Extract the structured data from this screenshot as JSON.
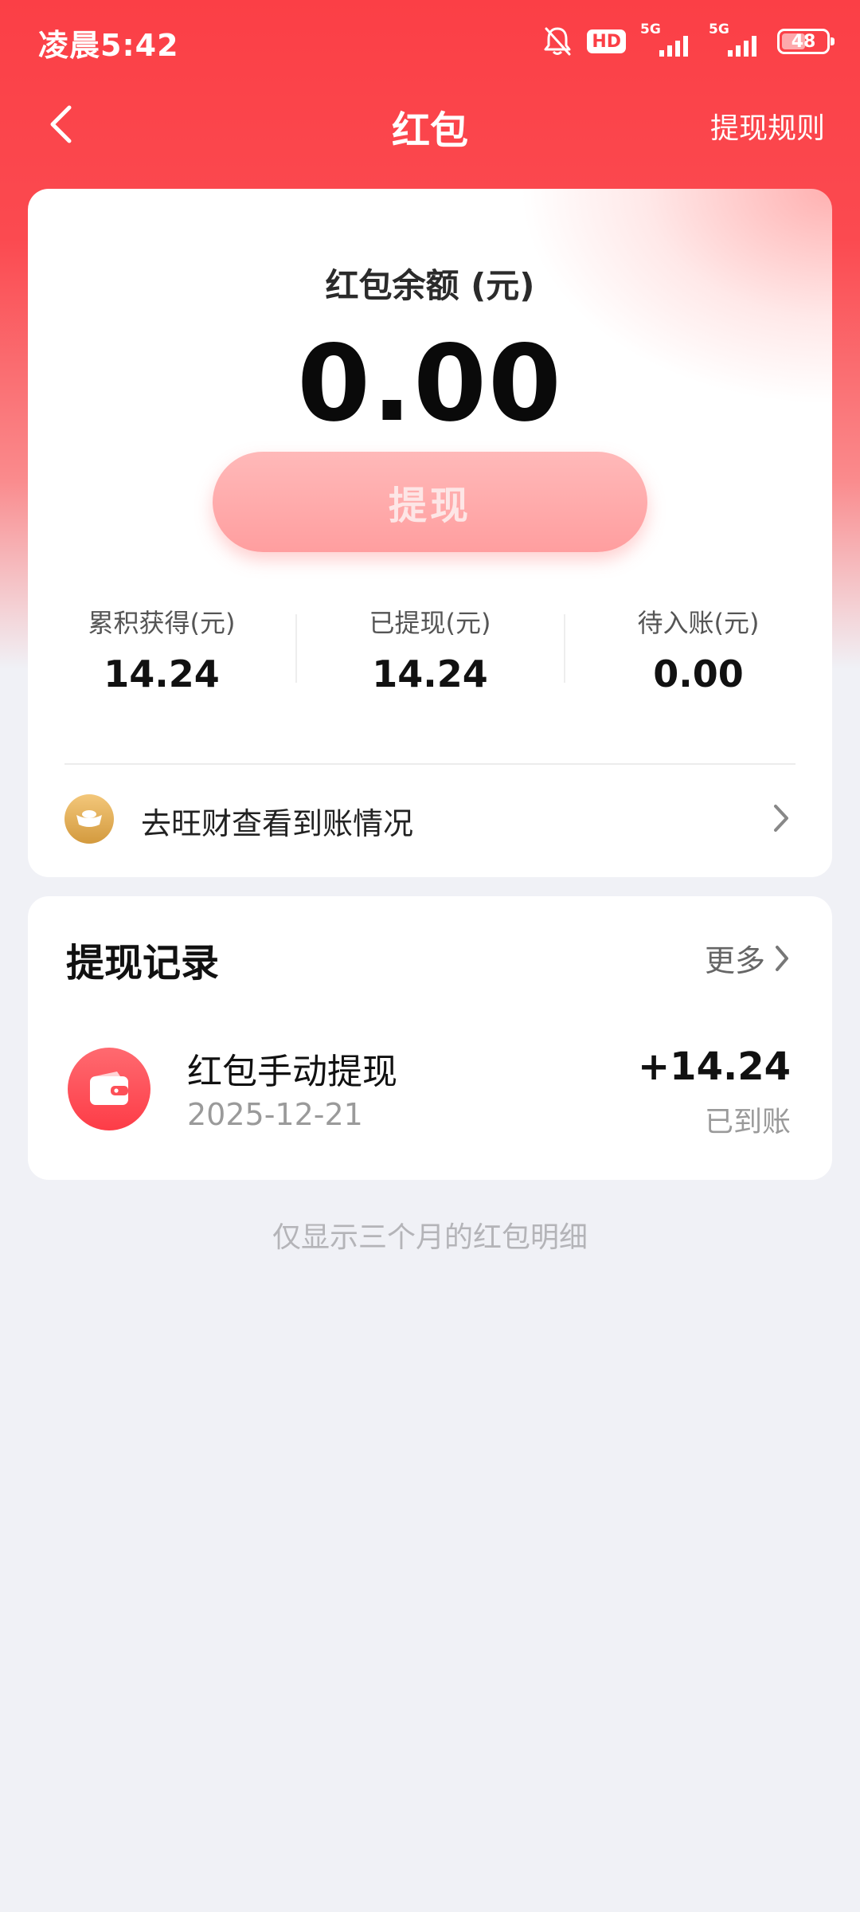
{
  "status_bar": {
    "time": "凌晨5:42",
    "hd_label": "HD",
    "net1_label": "5G",
    "net2_label": "5G",
    "battery_level": "48"
  },
  "nav": {
    "title": "红包",
    "rules_label": "提现规则"
  },
  "balance": {
    "label": "红包余额 (元)",
    "amount": "0.00",
    "withdraw_label": "提现"
  },
  "stats": [
    {
      "label": "累积获得(元)",
      "value": "14.24"
    },
    {
      "label": "已提现(元)",
      "value": "14.24"
    },
    {
      "label": "待入账(元)",
      "value": "0.00"
    }
  ],
  "wangcai": {
    "label": "去旺财查看到账情况"
  },
  "records": {
    "title": "提现记录",
    "more_label": "更多",
    "items": [
      {
        "name": "红包手动提现",
        "date": "2025-12-21",
        "amount": "+14.24",
        "status": "已到账"
      }
    ]
  },
  "footnote": "仅显示三个月的红包明细",
  "colors": {
    "brand_red": "#fb3f46",
    "withdraw_button": "#ff9e9f",
    "page_bg": "#f0f1f6"
  }
}
